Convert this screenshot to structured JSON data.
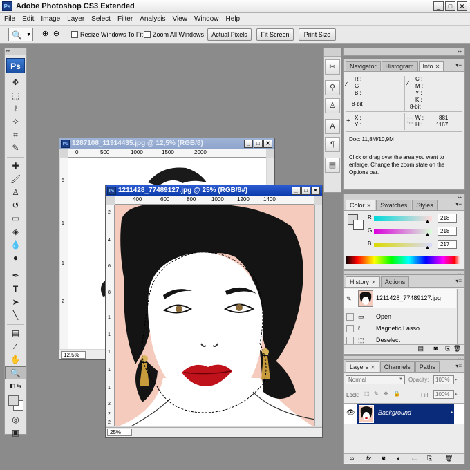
{
  "window": {
    "title": "Adobe Photoshop CS3 Extended",
    "logo": "Ps",
    "min": "_",
    "max": "□",
    "close": "✕"
  },
  "menu": [
    "File",
    "Edit",
    "Image",
    "Layer",
    "Select",
    "Filter",
    "Analysis",
    "View",
    "Window",
    "Help"
  ],
  "options": {
    "resize_label": "Resize Windows To Fit",
    "zoom_all_label": "Zoom All Windows",
    "actual_pixels": "Actual Pixels",
    "fit_screen": "Fit Screen",
    "print_size": "Print Size"
  },
  "toolbox": {
    "logo": "Ps"
  },
  "doc_back": {
    "title": "1287108_11914435.jpg @ 12,5% (RGB/8)",
    "ruler_h": [
      "0",
      "500",
      "1000",
      "1500",
      "2000"
    ],
    "ruler_v": [
      "5",
      "1",
      "1",
      "2"
    ],
    "zoom": "12,5%"
  },
  "doc_front": {
    "title": "1211428_77489127.jpg @ 25% (RGB/8#)",
    "ruler_h": [
      "400",
      "600",
      "800",
      "1000",
      "1200",
      "1400"
    ],
    "ruler_v": [
      "2",
      "4",
      "6",
      "8",
      "1",
      "1",
      "1",
      "1",
      "1",
      "2",
      "2",
      "2",
      "2"
    ],
    "zoom": "25%"
  },
  "navigator_panel": {
    "tabs": [
      "Navigator",
      "Histogram",
      "Info"
    ],
    "active": "Info",
    "r": "R :",
    "g": "G :",
    "b": "B :",
    "c": "C :",
    "m": "M :",
    "y": "Y :",
    "k": "K :",
    "bit_left": "8-bit",
    "bit_right": "8-bit",
    "x": "X :",
    "yy": "Y :",
    "w": "W :",
    "h": "H :",
    "w_val": "881",
    "h_val": "1167",
    "doc": "Doc: 11,8M/10,9M",
    "hint": "Click or drag over the area you want to enlarge. Change the zoom state on the Options bar."
  },
  "color_panel": {
    "tabs": [
      "Color",
      "Swatches",
      "Styles"
    ],
    "r_label": "R",
    "g_label": "G",
    "b_label": "B",
    "r_val": "218",
    "g_val": "218",
    "b_val": "217"
  },
  "history_panel": {
    "tabs": [
      "History",
      "Actions"
    ],
    "snapshot": "1211428_77489127.jpg",
    "steps": [
      "Open",
      "Magnetic Lasso",
      "Deselect"
    ]
  },
  "layers_panel": {
    "tabs": [
      "Layers",
      "Channels",
      "Paths"
    ],
    "blend": "Normal",
    "opacity_label": "Opacity:",
    "opacity": "100%",
    "lock_label": "Lock:",
    "fill_label": "Fill:",
    "fill": "100%",
    "layer_name": "Background"
  }
}
